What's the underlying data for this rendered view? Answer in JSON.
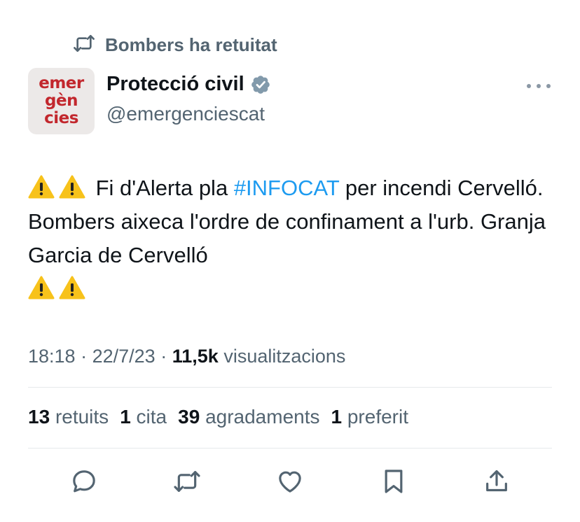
{
  "retweet": {
    "label": "Bombers ha retuitat"
  },
  "author": {
    "avatar_lines": [
      "emer",
      "gèn",
      "cies"
    ],
    "name": "Protecció civil",
    "handle": "@emergenciescat"
  },
  "tweet": {
    "text_before": "Fi d'Alerta pla",
    "hashtag": "#INFOCAT",
    "text_after": "per incendi Cervelló. Bombers aixeca l'ordre de confinament a l'urb. Granja Garcia de Cervelló"
  },
  "meta": {
    "time": "18:18",
    "separator": "·",
    "date": "22/7/23",
    "views_count": "11,5k",
    "views_label": "visualitzacions"
  },
  "stats": {
    "retweets_count": "13",
    "retweets_label": "retuits",
    "quotes_count": "1",
    "quotes_label": "cita",
    "likes_count": "39",
    "likes_label": "agradaments",
    "bookmarks_count": "1",
    "bookmarks_label": "preferit"
  },
  "icons": {
    "retweet": "retweet-icon",
    "verified": "verified-badge-icon",
    "more": "more-options-icon",
    "warning": "warning-emoji-icon",
    "reply": "reply-icon",
    "like": "heart-icon",
    "bookmark": "bookmark-icon",
    "share": "share-icon"
  },
  "colors": {
    "text": "#0f1419",
    "secondary": "#536471",
    "link": "#1d9bf0",
    "avatar_text": "#c2272d",
    "avatar_bg": "#ece9e8",
    "verified": "#829aab"
  }
}
